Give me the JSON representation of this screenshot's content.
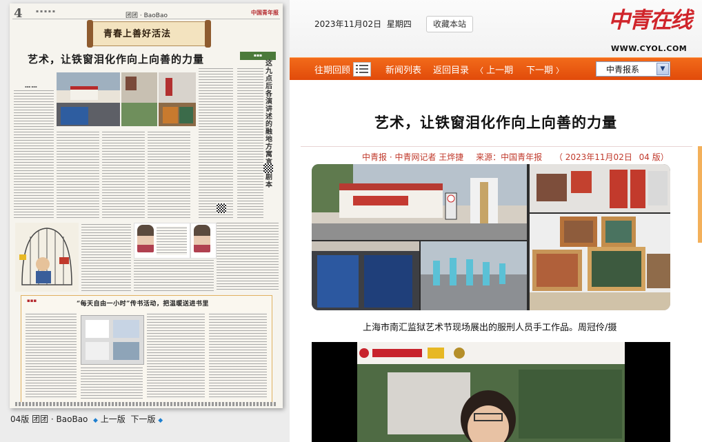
{
  "paper": {
    "page_number": "4",
    "section": "团团 · BaoBao",
    "banner_title": "青春上善好活法",
    "headline": "艺术，让铁窗泪化作向上向善的力量",
    "side_vertical": "这九点后各演讲述的融地方 寓言 · 剧本",
    "feature_head": "“每天自由一小时”传书活动，把温暖送进书里",
    "logo": "中国青年报"
  },
  "left_pager": {
    "edition": "04版 团团 · BaoBao",
    "prev": "上一版",
    "next": "下一版"
  },
  "site": {
    "date": "2023年11月02日",
    "weekday": "星期四",
    "bookmark_label": "收藏本站",
    "logo_cn": "中青在线",
    "logo_url": "WWW.CYOL.COM"
  },
  "nav": {
    "past_review": "往期回顾",
    "news_list": "新闻列表",
    "back_to_index": "返回目录",
    "prev_issue": "上一期",
    "next_issue": "下一期",
    "select_value": "中青报系"
  },
  "article": {
    "title": "艺术，让铁窗泪化作向上向善的力量",
    "byline": "中青报 · 中青网记者 王烨捷",
    "source": "来源：中国青年报",
    "date": "（ 2023年11月02日 ",
    "edition": "04 版）",
    "caption": "上海市南汇监狱艺术节现场展出的服刑人员手工作品。周冠伶/摄"
  },
  "colors": {
    "accent_orange": "#e9560f",
    "brand_red": "#d0252b",
    "meta_red": "#c0392b"
  }
}
